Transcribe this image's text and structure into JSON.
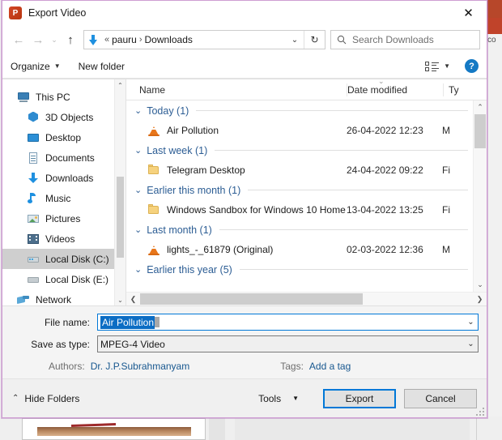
{
  "window": {
    "title": "Export Video",
    "app_icon": "powerpoint-icon",
    "close_label": "✕"
  },
  "nav": {
    "back": "←",
    "forward": "→",
    "recent": "⌄",
    "up": "↑",
    "breadcrumb": {
      "prefix": "«",
      "items": [
        "pauru",
        "Downloads"
      ],
      "separator": "›"
    },
    "address_caret": "⌄",
    "refresh": "↻",
    "search_placeholder": "Search Downloads"
  },
  "toolbar": {
    "organize": "Organize",
    "organize_caret": "▼",
    "new_folder": "New folder",
    "view_caret": "▼",
    "help": "?"
  },
  "sidebar": {
    "items": [
      {
        "label": "This PC",
        "icon": "this-pc-icon",
        "indent": false,
        "selected": false
      },
      {
        "label": "3D Objects",
        "icon": "3d-objects-icon",
        "indent": true,
        "selected": false
      },
      {
        "label": "Desktop",
        "icon": "desktop-icon",
        "indent": true,
        "selected": false
      },
      {
        "label": "Documents",
        "icon": "documents-icon",
        "indent": true,
        "selected": false
      },
      {
        "label": "Downloads",
        "icon": "downloads-icon",
        "indent": true,
        "selected": false
      },
      {
        "label": "Music",
        "icon": "music-icon",
        "indent": true,
        "selected": false
      },
      {
        "label": "Pictures",
        "icon": "pictures-icon",
        "indent": true,
        "selected": false
      },
      {
        "label": "Videos",
        "icon": "videos-icon",
        "indent": true,
        "selected": false
      },
      {
        "label": "Local Disk (C:)",
        "icon": "disk-icon",
        "indent": true,
        "selected": true
      },
      {
        "label": "Local Disk (E:)",
        "icon": "disk-icon",
        "indent": true,
        "selected": false
      },
      {
        "label": "Network",
        "icon": "network-icon",
        "indent": false,
        "selected": false
      }
    ]
  },
  "filelist": {
    "columns": {
      "name": "Name",
      "date_modified": "Date modified",
      "type": "Ty"
    },
    "groups": [
      {
        "label": "Today (1)",
        "rows": [
          {
            "name": "Air Pollution",
            "date": "26-04-2022 12:23",
            "type": "M",
            "icon": "vlc-media-icon"
          }
        ]
      },
      {
        "label": "Last week (1)",
        "rows": [
          {
            "name": "Telegram Desktop",
            "date": "24-04-2022 09:22",
            "type": "Fi",
            "icon": "folder-icon"
          }
        ]
      },
      {
        "label": "Earlier this month (1)",
        "rows": [
          {
            "name": "Windows Sandbox for Windows 10 Home",
            "date": "13-04-2022 13:25",
            "type": "Fi",
            "icon": "folder-icon"
          }
        ]
      },
      {
        "label": "Last month (1)",
        "rows": [
          {
            "name": "lights_-_61879 (Original)",
            "date": "02-03-2022 12:36",
            "type": "M",
            "icon": "vlc-media-icon"
          }
        ]
      },
      {
        "label": "Earlier this year (5)",
        "rows": []
      }
    ]
  },
  "form": {
    "file_name_label": "File name:",
    "file_name_value": "Air Pollution",
    "save_as_type_label": "Save as type:",
    "save_as_type_value": "MPEG-4 Video",
    "authors_label": "Authors:",
    "authors_value": "Dr. J.P.Subrahmanyam",
    "tags_label": "Tags:",
    "tags_value": "Add a tag"
  },
  "footer": {
    "hide_folders": "Hide Folders",
    "hide_folders_chevron": "⌃",
    "tools": "Tools",
    "tools_caret": "▼",
    "export": "Export",
    "cancel": "Cancel"
  },
  "background": {
    "right_text": "co"
  },
  "colors": {
    "accent": "#0078d7",
    "selection": "#0b6dc4",
    "group_header": "#2c5d94",
    "link": "#17578f",
    "powerpoint": "#d24726",
    "dialog_border": "#cf9ed2"
  }
}
